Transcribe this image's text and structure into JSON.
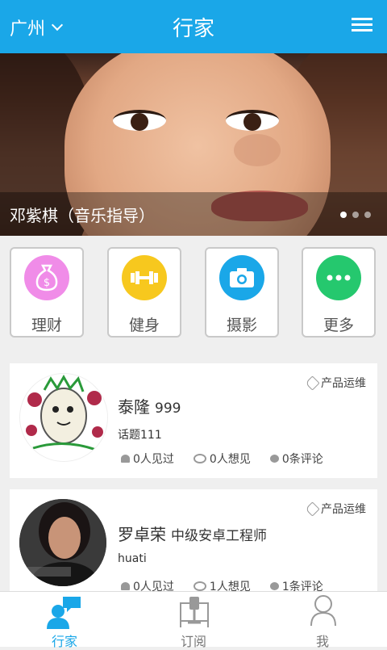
{
  "header": {
    "city": "广州",
    "title": "行家"
  },
  "banner": {
    "caption": "邓紫棋（音乐指导）",
    "slides": 3,
    "active_slide": 1
  },
  "categories": [
    {
      "label": "理财",
      "icon": "money-bag-icon",
      "color": "#f08ce8"
    },
    {
      "label": "健身",
      "icon": "dumbbell-icon",
      "color": "#f7c81e"
    },
    {
      "label": "摄影",
      "icon": "camera-icon",
      "color": "#1aa7e8"
    },
    {
      "label": "更多",
      "icon": "more-dots-icon",
      "color": "#25c86e"
    }
  ],
  "experts": [
    {
      "name": "泰隆",
      "title": "999",
      "tag": "产品运维",
      "topic": "话题111",
      "met": "0人见过",
      "want": "0人想见",
      "comments": "0条评论"
    },
    {
      "name": "罗卓荣",
      "title": "中级安卓工程师",
      "tag": "产品运维",
      "topic": "huati",
      "met": "0人见过",
      "want": "1人想见",
      "comments": "1条评论"
    }
  ],
  "tabs": [
    {
      "label": "行家",
      "active": true
    },
    {
      "label": "订阅",
      "active": false
    },
    {
      "label": "我",
      "active": false
    }
  ],
  "colors": {
    "primary": "#1aa7e8"
  }
}
